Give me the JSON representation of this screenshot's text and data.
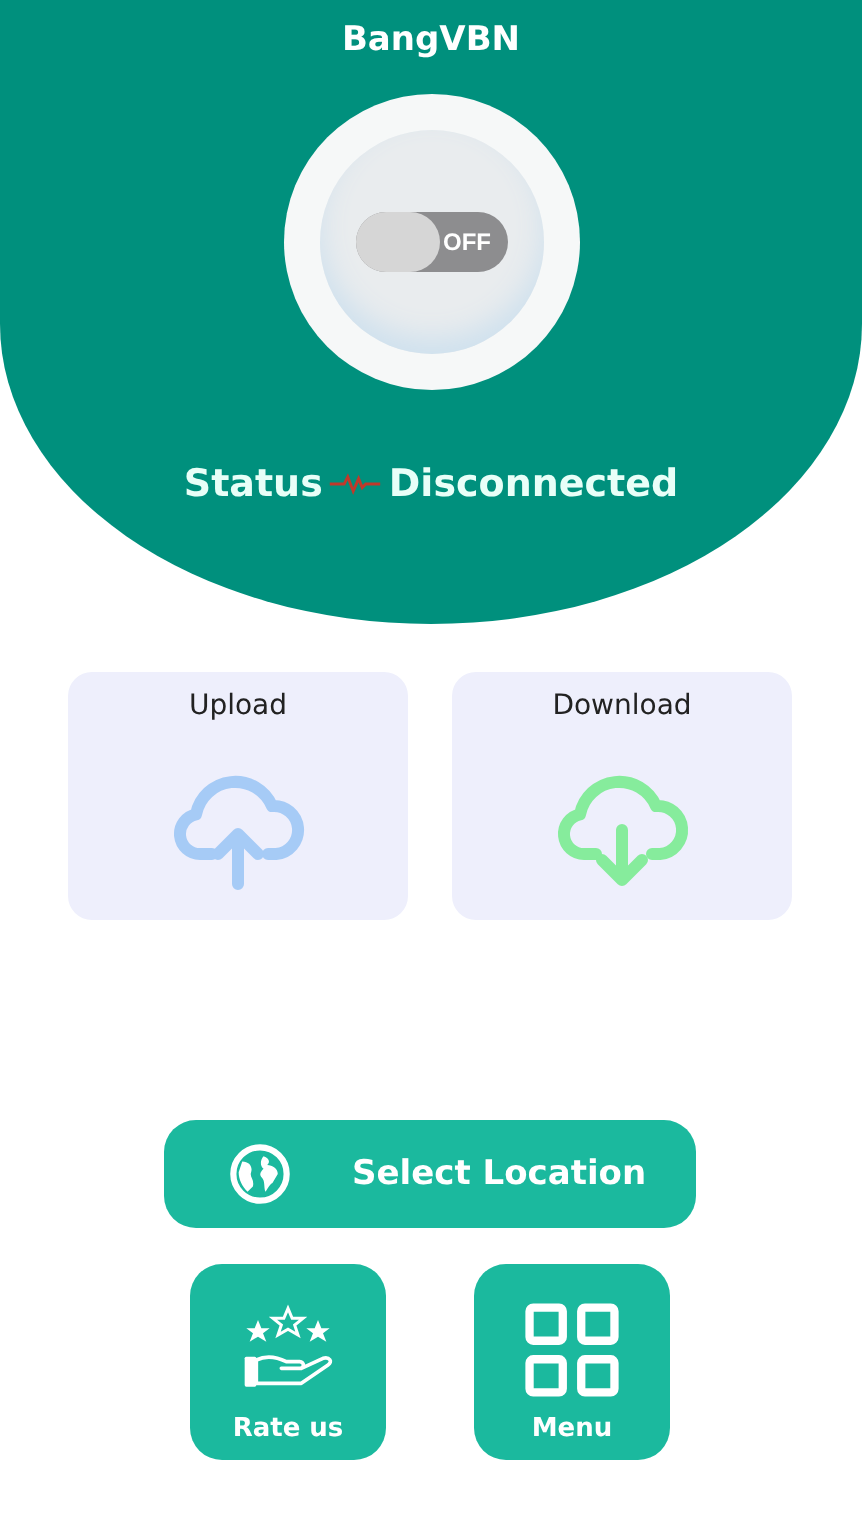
{
  "app_title": "BangVBN",
  "power_switch": {
    "label": "OFF",
    "on": false
  },
  "status": {
    "label": "Status",
    "value": "Disconnected",
    "connected": false
  },
  "transfer_cards": [
    {
      "kind": "upload",
      "label": "Upload"
    },
    {
      "kind": "download",
      "label": "Download"
    }
  ],
  "location_button": {
    "label": "Select Location"
  },
  "action_buttons": [
    {
      "kind": "rate",
      "label": "Rate us"
    },
    {
      "kind": "menu",
      "label": "Menu"
    }
  ]
}
